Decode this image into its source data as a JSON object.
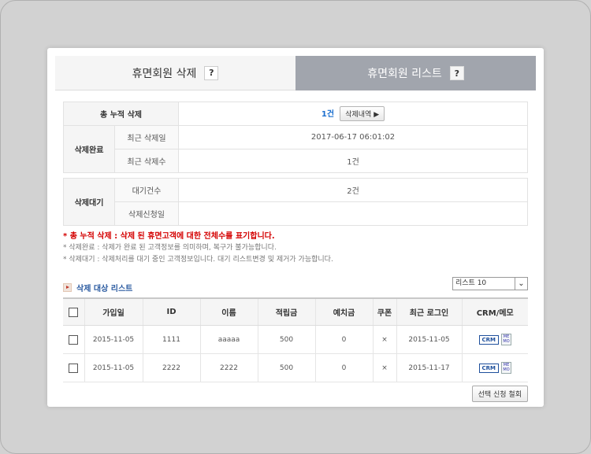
{
  "tabs": {
    "left_label": "휴면회원 삭제",
    "right_label": "휴면회원 리스트",
    "help_label": "?"
  },
  "summary": {
    "total_label": "총 누적 삭제",
    "total_count": "1건",
    "history_button": "삭제내역 ▶",
    "complete_label": "삭제완료",
    "last_date_label": "최근 삭제일",
    "last_date_value": "2017-06-17 06:01:02",
    "last_count_label": "최근 삭제수",
    "last_count_value": "1건",
    "wait_label": "삭제대기",
    "wait_count_label": "대기건수",
    "wait_count_value": "2건",
    "request_date_label": "삭제신청일",
    "request_date_value": ""
  },
  "notes": {
    "note1": "* 총 누적 삭제 : 삭제 된 휴면고객에 대한 전체수를 표기합니다.",
    "note2": "* 삭제완료 : 삭제가 완료 된 고객정보를 의미하며, 복구가 불가능합니다.",
    "note3": "* 삭제대기 : 삭제처리를 대기 중인 고객정보입니다. 대기 리스트변경 및 제거가 가능합니다."
  },
  "list": {
    "title": "삭제 대상 리스트",
    "page_size_selected": "리스트 10",
    "columns": [
      "가입일",
      "ID",
      "이름",
      "적립금",
      "예치금",
      "쿠폰",
      "최근 로그인",
      "CRM/메모"
    ],
    "rows": [
      {
        "join_date": "2015-11-05",
        "id": "1111",
        "name": "aaaaa",
        "points": "500",
        "deposit": "0",
        "coupon": "×",
        "last_login": "2015-11-05",
        "crm": "CRM",
        "memo": "ME MO"
      },
      {
        "join_date": "2015-11-05",
        "id": "2222",
        "name": "2222",
        "points": "500",
        "deposit": "0",
        "coupon": "×",
        "last_login": "2015-11-17",
        "crm": "CRM",
        "memo": "ME MO"
      }
    ],
    "withdraw_button": "선택 신청 철회"
  }
}
